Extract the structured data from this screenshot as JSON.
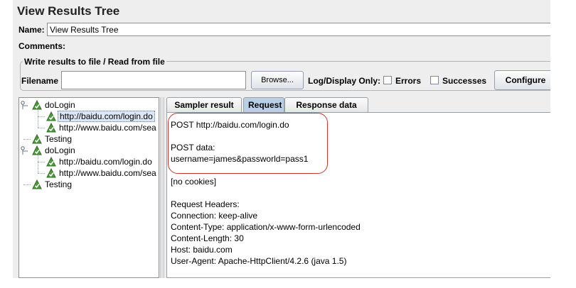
{
  "title": "View Results Tree",
  "name_label": "Name:",
  "name_value": "View Results Tree",
  "comments_label": "Comments:",
  "file_group_title": "Write results to file / Read from file",
  "filename_label": "Filename",
  "filename_value": "",
  "browse_label": "Browse...",
  "log_display_label": "Log/Display Only:",
  "errors_label": "Errors",
  "successes_label": "Successes",
  "configure_label": "Configure",
  "tree": [
    {
      "label": "doLogin",
      "level": 0,
      "handle": true
    },
    {
      "label": "http://baidu.com/login.do",
      "level": 1,
      "handle": false,
      "selected": true
    },
    {
      "label": "http://www.baidu.com/sea",
      "level": 1,
      "handle": false
    },
    {
      "label": "Testing",
      "level": 0,
      "handle": false
    },
    {
      "label": "doLogin",
      "level": 0,
      "handle": true
    },
    {
      "label": "http://baidu.com/login.do",
      "level": 1,
      "handle": false
    },
    {
      "label": "http://www.baidu.com/sea",
      "level": 1,
      "handle": false
    },
    {
      "label": "Testing",
      "level": 0,
      "handle": false
    }
  ],
  "tabs": [
    {
      "label": "Sampler result",
      "active": false
    },
    {
      "label": "Request",
      "active": true
    },
    {
      "label": "Response data",
      "active": false
    }
  ],
  "request_lines": [
    "POST http://baidu.com/login.do",
    "",
    "POST data:",
    "username=james&passworld=pass1",
    "",
    "[no cookies]",
    "",
    "Request Headers:",
    "Connection: keep-alive",
    "Content-Type: application/x-www-form-urlencoded",
    "Content-Length: 30",
    "Host: baidu.com",
    "User-Agent: Apache-HttpClient/4.2.6 (java 1.5)"
  ],
  "colors": {
    "success_icon": "#4e9a3c",
    "oval": "#c0392b",
    "active_tab": "#b9cfe6"
  }
}
